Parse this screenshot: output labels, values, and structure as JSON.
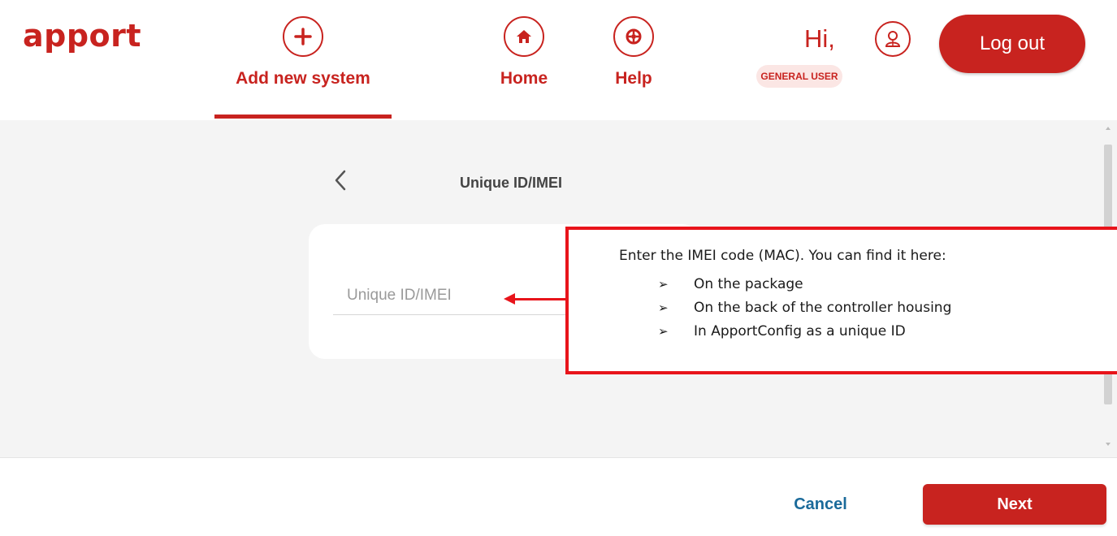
{
  "header": {
    "logo": "apport",
    "nav": [
      {
        "label": "Add new system",
        "icon": "plus-icon",
        "active": true
      },
      {
        "label": "Home",
        "icon": "home-icon",
        "active": false
      },
      {
        "label": "Help",
        "icon": "help-icon",
        "active": false
      }
    ],
    "greeting": "Hi,",
    "role": "GENERAL USER",
    "logout_label": "Log out"
  },
  "page": {
    "title": "Unique ID/IMEI",
    "input": {
      "placeholder": "Unique ID/IMEI",
      "value": ""
    }
  },
  "callout": {
    "text": "Enter the IMEI code (MAC). You can find it here:",
    "items": [
      "On the package",
      "On the back of the controller housing",
      "In ApportConfig as a unique ID"
    ]
  },
  "footer": {
    "cancel_label": "Cancel",
    "next_label": "Next"
  },
  "colors": {
    "brand": "#c8231f",
    "callout_border": "#e8141b",
    "link": "#1a6a9a",
    "background": "#f4f4f4"
  }
}
